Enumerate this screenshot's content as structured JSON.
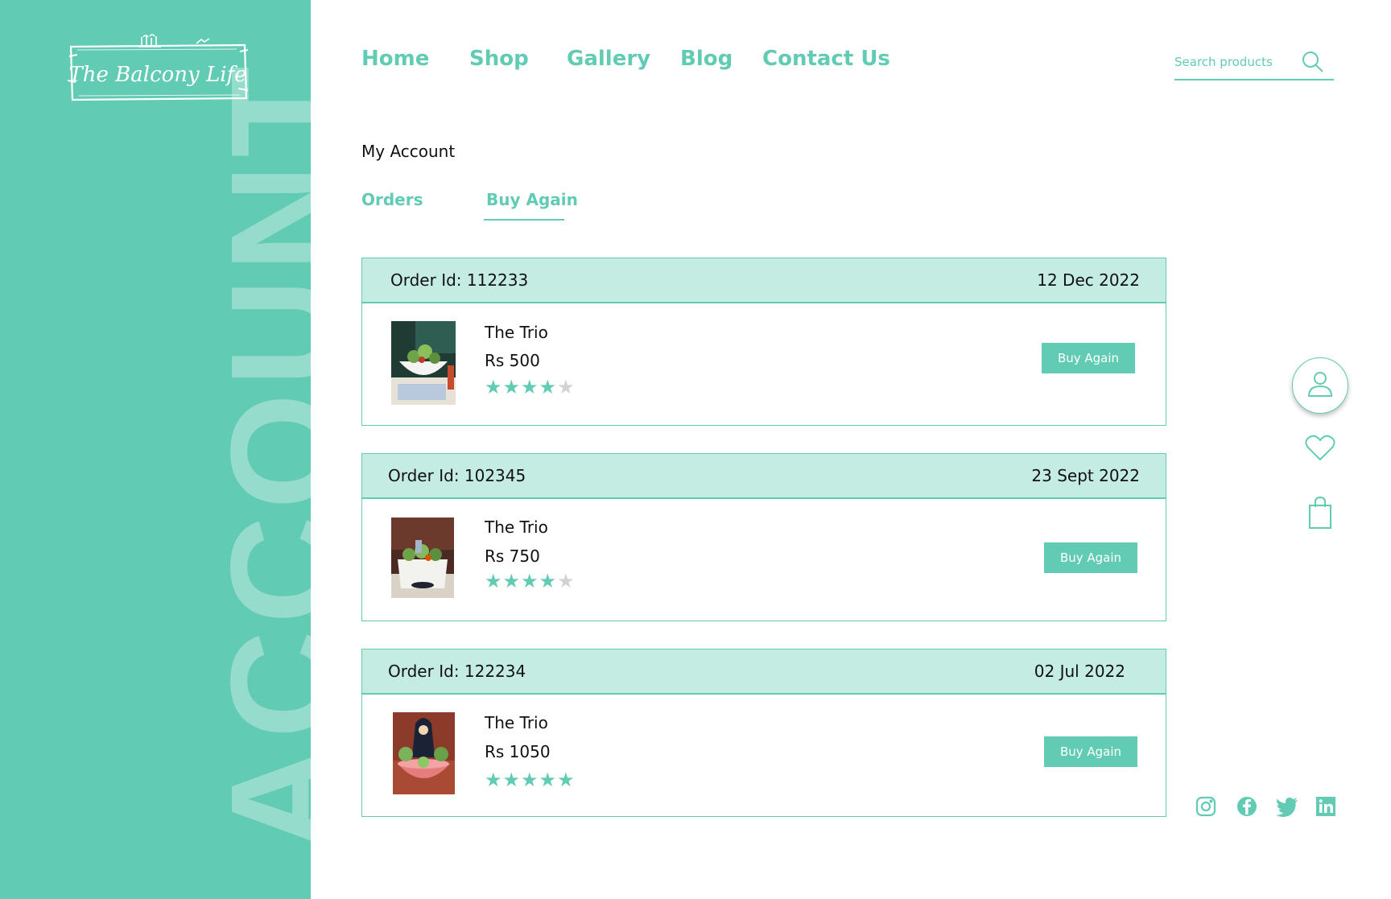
{
  "brand": {
    "name": "The Balcony Life"
  },
  "sidebar": {
    "watermark": "ACCOUNT"
  },
  "nav": {
    "links": [
      "Home",
      "Shop",
      "Gallery",
      "Blog",
      "Contact Us"
    ]
  },
  "search": {
    "placeholder": "Search products",
    "value": ""
  },
  "account": {
    "title": "My Account",
    "tabs": [
      {
        "label": "Orders",
        "active": false
      },
      {
        "label": "Buy Again",
        "active": true
      }
    ]
  },
  "orders": [
    {
      "id_label": "Order Id: 112233",
      "date": "12 Dec 2022",
      "item_name": "The Trio",
      "price": "Rs 500",
      "rating": 4,
      "button": "Buy Again"
    },
    {
      "id_label": "Order Id: 102345",
      "date": "23 Sept 2022",
      "item_name": "The Trio",
      "price": "Rs 750",
      "rating": 4,
      "button": "Buy Again"
    },
    {
      "id_label": "Order Id: 122234",
      "date": "02 Jul 2022",
      "item_name": "The Trio",
      "price": "Rs 1050",
      "rating": 5,
      "button": "Buy Again"
    }
  ],
  "rating_max": 5,
  "icons": {
    "search": "search-icon",
    "user": "user-icon",
    "wishlist": "heart-icon",
    "cart": "shopping-bag-icon",
    "social": [
      "instagram-icon",
      "facebook-icon",
      "twitter-icon",
      "linkedin-icon"
    ]
  },
  "colors": {
    "accent": "#62cbb3",
    "header_fill": "#c5ece3",
    "star_off": "#d2d2d2"
  }
}
